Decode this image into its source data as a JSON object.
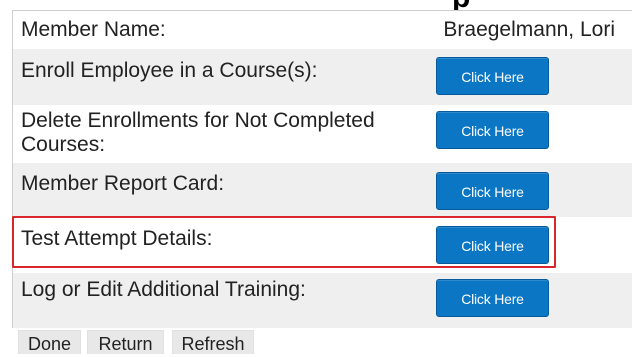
{
  "header": {
    "title_fragment": "p"
  },
  "member": {
    "label": "Member Name:",
    "value": "Braegelmann, Lori"
  },
  "rows": [
    {
      "label": "Enroll Employee in a Course(s):",
      "button": "Click Here"
    },
    {
      "label": "Delete Enrollments for Not Completed Courses:",
      "button": "Click Here"
    },
    {
      "label": "Member Report Card:",
      "button": "Click Here"
    },
    {
      "label": "Test Attempt Details:",
      "button": "Click Here"
    },
    {
      "label": "Log or Edit Additional Training:",
      "button": "Click Here"
    }
  ],
  "footer": {
    "done": "Done",
    "return": "Return",
    "refresh": "Refresh"
  },
  "colors": {
    "button": "#0a76c4",
    "highlight": "#d9262b",
    "alt_row": "#efefef"
  }
}
